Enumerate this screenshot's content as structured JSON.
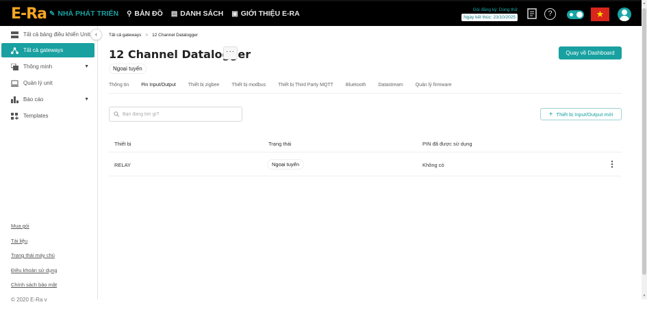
{
  "topbar": {
    "logo": "E-Ra",
    "nav": [
      {
        "label": "NHÀ PHÁT TRIỂN",
        "icon": "pen-icon"
      },
      {
        "label": "BẢN ĐỒ",
        "icon": "map-pin-icon"
      },
      {
        "label": "DANH SÁCH",
        "icon": "list-icon"
      },
      {
        "label": "GIỚI THIỆU E-RA",
        "icon": "info-icon"
      }
    ],
    "trial_label": "Gói đăng ký: Dùng thử",
    "trial_end": "Ngày kết thúc: 23/10/2025",
    "help_glyph": "?",
    "flag_glyph": "★",
    "colors": {
      "accent": "#19a0a0",
      "logo": "#f5a623",
      "flag": "#da251d"
    }
  },
  "sidebar": {
    "items": [
      {
        "label": "Tất cả bảng điều khiển Units",
        "icon": "dashboard-icon"
      },
      {
        "label": "Tất cả gateways",
        "icon": "gateway-icon"
      },
      {
        "label": "Thông minh",
        "icon": "smart-icon"
      },
      {
        "label": "Quản lý unit",
        "icon": "unit-icon"
      },
      {
        "label": "Báo cáo",
        "icon": "report-icon"
      },
      {
        "label": "Templates",
        "icon": "templates-icon"
      }
    ],
    "collapse_glyph": "‹",
    "links": [
      "Mua gói",
      "Tài liệu",
      "Trạng thái máy chủ",
      "Điều khoản sử dụng",
      "Chính sách bảo mật"
    ],
    "copyright": "© 2020 E-Ra v"
  },
  "breadcrumb": {
    "root": "Tất cả gateways",
    "sep": ">",
    "current": "12 Channel Datalogger"
  },
  "page": {
    "title": "12 Channel Datalogger",
    "more": "···",
    "status": "Ngoại tuyến",
    "back_button": "Quay về Dashboard"
  },
  "tabs": [
    "Thông tin",
    "Pin Input/Output",
    "Thiết bị zigbee",
    "Thiết bị modbus",
    "Thiết bị Third Party MQTT",
    "Bluetooth",
    "Datastream",
    "Quản lý firmware"
  ],
  "active_tab": "Pin Input/Output",
  "search": {
    "placeholder": "Bạn đang tìm gì?"
  },
  "add_button": {
    "plus": "+",
    "label": "Thiết bị Input/Output mới"
  },
  "table": {
    "headers": [
      "Thiết bị",
      "Trạng thái",
      "PIN đã được sử dụng"
    ],
    "rows": [
      {
        "device": "RELAY",
        "status": "Ngoại tuyến",
        "pins": "Không có",
        "menu": "⋮"
      }
    ]
  }
}
